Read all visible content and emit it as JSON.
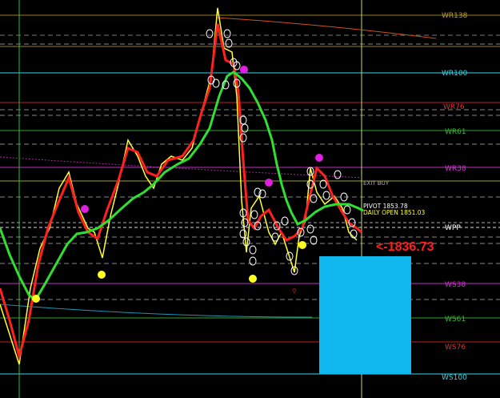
{
  "levels": [
    {
      "label": "WR138",
      "color": "#c0a030"
    },
    {
      "label": "WR100",
      "color": "#2fd8e8"
    },
    {
      "label": "WR76",
      "color": "#e03030"
    },
    {
      "label": "WR61",
      "color": "#30c030"
    },
    {
      "label": "WR38",
      "color": "#e030e0"
    },
    {
      "label": "WPP",
      "color": "#ffffff"
    },
    {
      "label": "WS38",
      "color": "#e030e0"
    },
    {
      "label": "WS61",
      "color": "#30c030"
    },
    {
      "label": "WS76",
      "color": "#e03030"
    },
    {
      "label": "WS100",
      "color": "#2fd8e8"
    }
  ],
  "annotations": {
    "exit_buy": "EXIT BUY",
    "pivot": "PIVOT 1853.78",
    "daily_open": "DAILY OPEN 1851.03",
    "price_marker": "<-1836.73",
    "colors": {
      "pivot": "#ffffff",
      "daily_open": "#ffff30",
      "price_marker": "#ff2020",
      "fast_ma": "#ff2020",
      "slow_ma": "#30e030",
      "price": "#ffff30",
      "box": "#10b8f0"
    }
  }
}
